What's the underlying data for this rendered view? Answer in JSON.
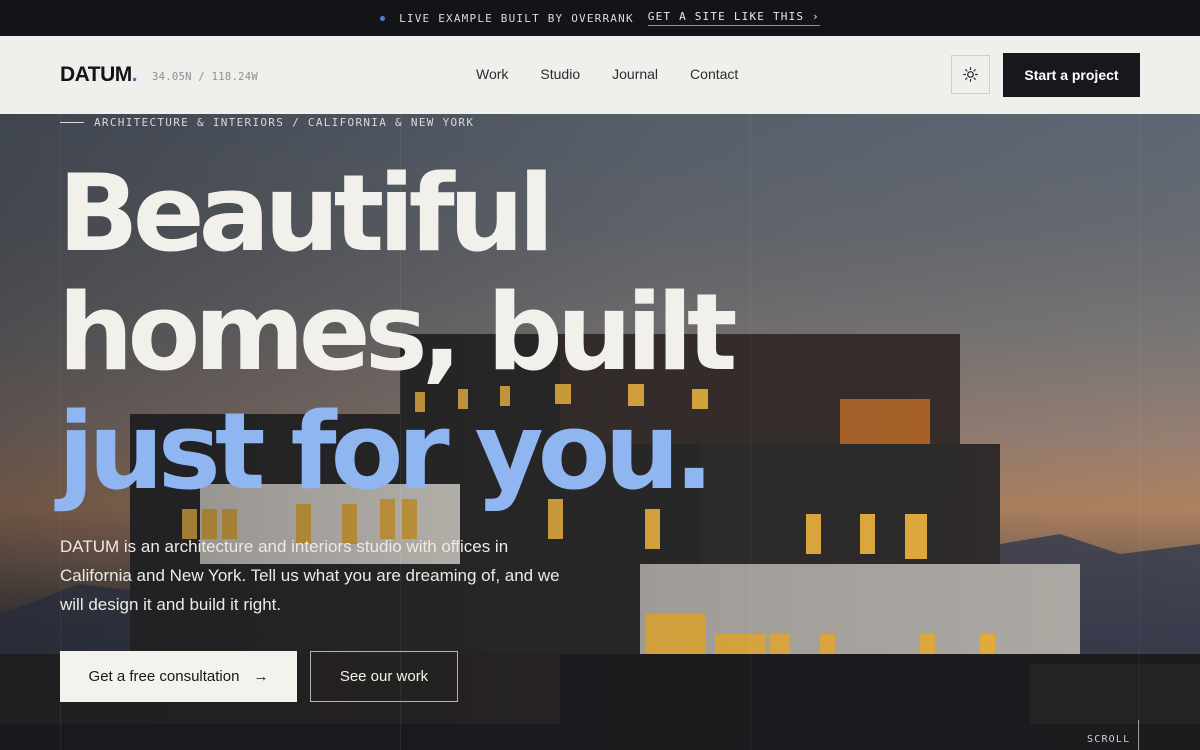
{
  "topbar": {
    "message": "LIVE EXAMPLE BUILT BY OVERRANK",
    "cta": "GET A SITE LIKE THIS ›"
  },
  "header": {
    "logo": "DATUM",
    "logo_period": ".",
    "coords": "34.05N / 118.24W",
    "nav": [
      "Work",
      "Studio",
      "Journal",
      "Contact"
    ],
    "theme_icon": "sun-icon",
    "start_button": "Start a project"
  },
  "hero": {
    "eyebrow": "ARCHITECTURE & INTERIORS / CALIFORNIA & NEW YORK",
    "headline_line1": "Beautiful",
    "headline_line2": "homes, built",
    "headline_line3": "just for you.",
    "lede": "DATUM is an architecture and interiors studio with offices in California and New York. Tell us what you are dreaming of, and we will design it and build it right.",
    "primary_button": "Get a free consultation",
    "primary_arrow": "→",
    "secondary_button": "See our work",
    "scroll_label": "SCROLL"
  },
  "colors": {
    "accent": "#8fb6f0",
    "dark": "#16181b",
    "header_bg": "#efefeb"
  }
}
